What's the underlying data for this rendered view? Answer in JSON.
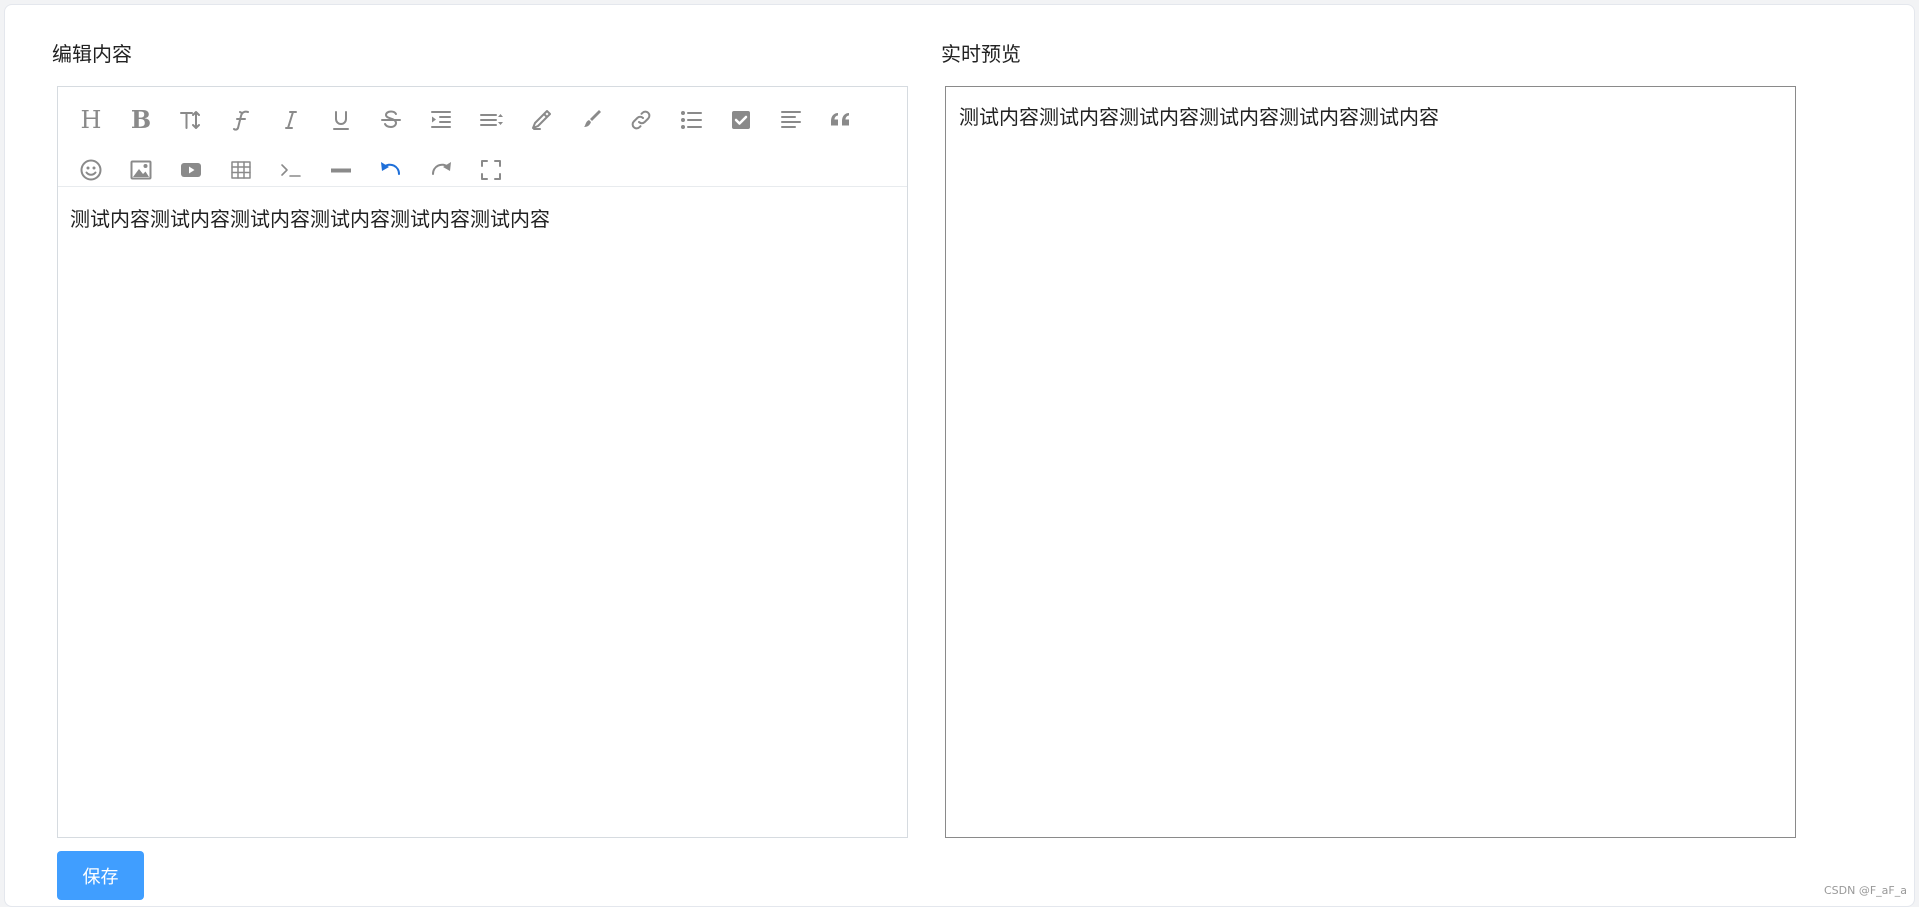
{
  "editor": {
    "title": "编辑内容",
    "content": "测试内容测试内容测试内容测试内容测试内容测试内容",
    "toolbar_row1": [
      "heading-icon",
      "bold-icon",
      "font-size-icon",
      "font-family-icon",
      "italic-icon",
      "underline-icon",
      "strikethrough-icon",
      "indent-icon",
      "line-height-icon",
      "font-color-icon",
      "background-color-icon",
      "link-icon",
      "bulleted-list-icon",
      "todo-checkbox-icon",
      "justify-icon",
      "blockquote-icon"
    ],
    "toolbar_row2": [
      "emoji-icon",
      "image-icon",
      "video-icon",
      "table-icon",
      "code-block-icon",
      "horizontal-rule-icon",
      "undo-icon",
      "redo-icon",
      "fullscreen-icon"
    ],
    "toolbar_text": {
      "heading": "H",
      "bold": "B"
    }
  },
  "preview": {
    "title": "实时预览",
    "content": "测试内容测试内容测试内容测试内容测试内容测试内容"
  },
  "actions": {
    "save_label": "保存"
  },
  "watermark": "CSDN @F_aF_a",
  "colors": {
    "accent": "#409eff",
    "icon": "#8a8a8a",
    "undo_active": "#1e6fd9"
  }
}
